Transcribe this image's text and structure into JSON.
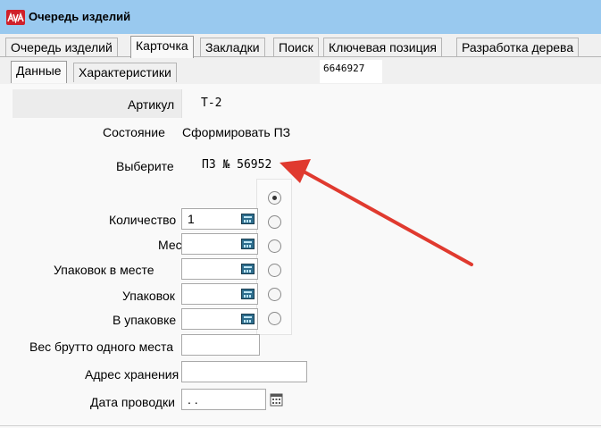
{
  "window": {
    "title": "Очередь изделий",
    "icon": "app-logo-icon"
  },
  "tabs": [
    {
      "label": "Очередь изделий",
      "active": false
    },
    {
      "label": "Карточка",
      "active": true
    },
    {
      "label": "Закладки",
      "active": false
    },
    {
      "label": "Поиск",
      "active": false
    },
    {
      "label": "Ключевая позиция",
      "active": false
    },
    {
      "label": "Разработка дерева",
      "active": false
    }
  ],
  "subtabs": [
    {
      "label": "Данные",
      "active": true
    },
    {
      "label": "Характеристики",
      "active": false
    }
  ],
  "code": "6646927",
  "form": {
    "article_label": "Артикул",
    "article_value": "Т-2",
    "state_label": "Состояние",
    "state_value": "Сформировать ПЗ",
    "select_label": "Выберите",
    "select_value": "ПЗ № 56952",
    "quantity_label": "Количество",
    "quantity_value": "1",
    "places_label": "Мест",
    "places_value": "",
    "packs_per_place_label": "Упаковок в месте",
    "packs_per_place_value": "",
    "packs_label": "Упаковок",
    "packs_value": "",
    "in_pack_label": "В упаковке",
    "in_pack_value": "",
    "gross_weight_label": "Вес брутто одного места",
    "gross_weight_value": "",
    "storage_address_label": "Адрес хранения",
    "storage_address_value": "",
    "posting_date_label": "Дата проводки",
    "posting_date_value": " . ."
  },
  "radio_options": {
    "count": 6,
    "selected_index": 0
  },
  "colors": {
    "titlebar": "#99c9ef",
    "arrow": "#e03a2f",
    "app_icon": "#d0202a"
  }
}
